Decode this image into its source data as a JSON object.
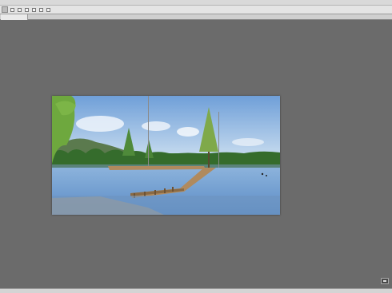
{
  "menu": {
    "items": [
      "",
      "",
      "",
      "",
      "",
      "",
      "",
      ""
    ]
  },
  "options_bar": {
    "options": [
      "",
      "",
      "",
      "",
      "",
      ""
    ]
  },
  "document": {
    "tab_label": "",
    "path_text": ""
  },
  "colors": {
    "workspace": "#6b6b6b",
    "sky_top": "#6f9fd8",
    "sky_bottom": "#d6e6f3",
    "water": "#6e9ed0",
    "boardwalk": "#b08a5e",
    "trees": "#3f7a34"
  },
  "icons": {
    "tool_icon": "marquee-icon",
    "corner": "screen-mode-icon"
  }
}
